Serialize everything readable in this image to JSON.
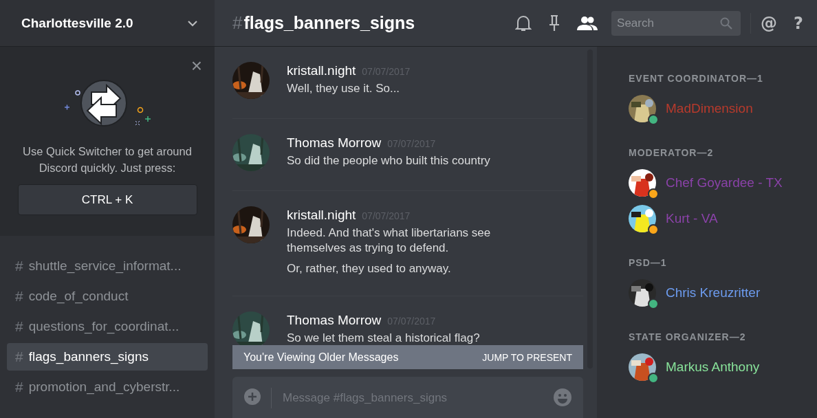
{
  "server": {
    "name": "Charlottesville 2.0"
  },
  "quick_switcher": {
    "close": "×",
    "text": "Use Quick Switcher to get around Discord quickly. Just press:",
    "shortcut": "CTRL + K"
  },
  "channels": [
    {
      "hash": "#",
      "name": "shuttle_service_informat...",
      "selected": false
    },
    {
      "hash": "#",
      "name": "code_of_conduct",
      "selected": false
    },
    {
      "hash": "#",
      "name": "questions_for_coordinat...",
      "selected": false
    },
    {
      "hash": "#",
      "name": "flags_banners_signs",
      "selected": true
    },
    {
      "hash": "#",
      "name": "promotion_and_cyberstr...",
      "selected": false
    }
  ],
  "header": {
    "hash": "#",
    "title": "flags_banners_signs",
    "search": {
      "placeholder": "Search"
    },
    "mention": "@",
    "help": "?"
  },
  "messages": [
    {
      "author": "kristall.night",
      "time": "07/07/2017",
      "lines": [
        "Well, they use it. So..."
      ]
    },
    {
      "author": "Thomas Morrow",
      "time": "07/07/2017",
      "lines": [
        "So did the people who built this country"
      ]
    },
    {
      "author": "kristall.night",
      "time": "07/07/2017",
      "lines": [
        "Indeed. And that's what libertarians see themselves as trying to defend.",
        "Or, rather, they used to anyway."
      ]
    },
    {
      "author": "Thomas Morrow",
      "time": "07/07/2017",
      "lines": [
        "So we let them steal a historical flag?"
      ]
    }
  ],
  "older_banner": {
    "text": "You're Viewing Older Messages",
    "action": "JUMP TO PRESENT"
  },
  "composer": {
    "placeholder": "Message #flags_banners_signs"
  },
  "member_groups": [
    {
      "title": "EVENT COORDINATOR—1",
      "members": [
        {
          "name": "MadDimension",
          "color": "#b83a2c",
          "status": {
            "color": "#43b581"
          }
        }
      ]
    },
    {
      "title": "MODERATOR—2",
      "members": [
        {
          "name": "Chef Goyardee - TX",
          "color": "#8a42a8",
          "status": {
            "color": "#faa61a"
          }
        },
        {
          "name": "Kurt - VA",
          "color": "#8a42a8",
          "status": {
            "color": "#faa61a"
          }
        }
      ]
    },
    {
      "title": "PSD—1",
      "members": [
        {
          "name": "Chris Kreuzritter",
          "color": "#6d9cf0",
          "status": {
            "color": "#43b581"
          }
        }
      ]
    },
    {
      "title": "STATE ORGANIZER—2",
      "members": [
        {
          "name": "Markus Anthony",
          "color": "#88e39a",
          "status": {
            "color": "#43b581"
          }
        }
      ]
    }
  ]
}
